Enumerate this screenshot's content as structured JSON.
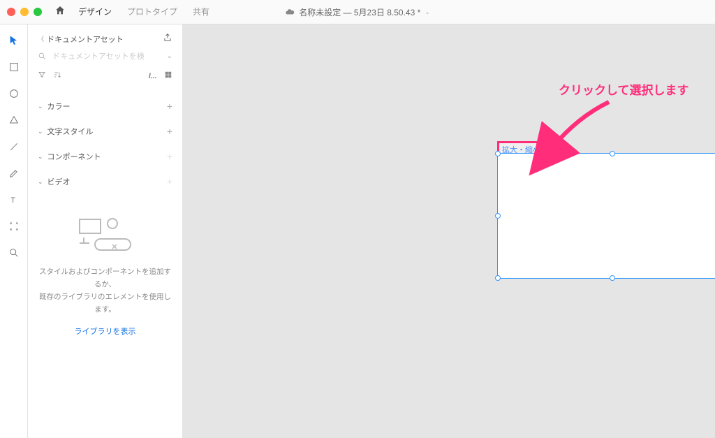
{
  "titlebar": {
    "tabs": {
      "design": "デザイン",
      "prototype": "プロトタイプ",
      "share": "共有"
    },
    "doc_title": "名称未設定 — 5月23日 8.50.43 *"
  },
  "panel": {
    "back_label": "ドキュメントアセット",
    "search_placeholder": "ドキュメントアセットを検",
    "sections": {
      "color": "カラー",
      "text_style": "文字スタイル",
      "component": "コンポーネント",
      "video": "ビデオ"
    },
    "empty_line1": "スタイルおよびコンポーネントを追加するか、",
    "empty_line2": "既存のライブラリのエレメントを使用します。",
    "library_link": "ライブラリを表示"
  },
  "canvas": {
    "artboard_label": "拡大・縮小！",
    "annotation": "クリックして選択します"
  }
}
